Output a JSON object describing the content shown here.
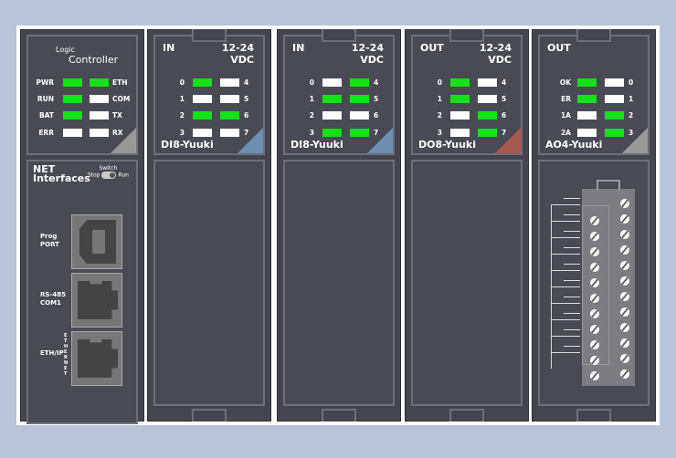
{
  "controller": {
    "title_small": "Logic",
    "title_big": "Controller",
    "leds": [
      {
        "label": "PWR",
        "on": true
      },
      {
        "label": "RUN",
        "on": true
      },
      {
        "label": "BAT",
        "on": true
      },
      {
        "label": "ERR",
        "on": false
      },
      {
        "label": "ETH",
        "on": true
      },
      {
        "label": "COM",
        "on": false
      },
      {
        "label": "TX",
        "on": false
      },
      {
        "label": "RX",
        "on": false
      }
    ],
    "net_title": [
      "NET",
      "Interfaces"
    ],
    "switch_label": "Switch",
    "switch_stop": "Stop",
    "switch_run": "Run",
    "switch_state": "Run",
    "ports": [
      {
        "label": [
          "Prog",
          "PORT"
        ],
        "type": "usb-b"
      },
      {
        "label": [
          "RS-485",
          "COM1"
        ],
        "type": "rj45"
      },
      {
        "label": [
          "ETH/IP"
        ],
        "type": "rj45",
        "side_label": "ETHERNET"
      }
    ]
  },
  "modules": [
    {
      "dir": "IN",
      "volt": [
        "12-24",
        "VDC"
      ],
      "name": "DI8-Yuuki",
      "corner": "#6a8fb0",
      "labels_left": [
        "0",
        "1",
        "2",
        "3"
      ],
      "labels_right": [
        "4",
        "5",
        "6",
        "7"
      ],
      "left_on": [
        true,
        false,
        true,
        false
      ],
      "right_on": [
        false,
        false,
        true,
        false
      ]
    },
    {
      "dir": "IN",
      "volt": [
        "12-24",
        "VDC"
      ],
      "name": "DI8-Yuuki",
      "corner": "#6a8fb0",
      "labels_left": [
        "0",
        "1",
        "2",
        "3"
      ],
      "labels_right": [
        "4",
        "5",
        "6",
        "7"
      ],
      "left_on": [
        false,
        true,
        false,
        true
      ],
      "right_on": [
        true,
        true,
        false,
        true
      ]
    },
    {
      "dir": "OUT",
      "volt": [
        "12-24",
        "VDC"
      ],
      "name": "DO8-Yuuki",
      "corner": "#a85a4e",
      "labels_left": [
        "0",
        "1",
        "2",
        "3"
      ],
      "labels_right": [
        "4",
        "5",
        "6",
        "7"
      ],
      "left_on": [
        true,
        true,
        false,
        false
      ],
      "right_on": [
        false,
        false,
        true,
        true
      ]
    },
    {
      "dir": "OUT",
      "volt": [
        "",
        ""
      ],
      "name": "AO4-Yuuki",
      "corner": "#999999",
      "labels_left": [
        "OK",
        "ER",
        "1A",
        "2A"
      ],
      "labels_right": [
        "0",
        "1",
        "2",
        "3"
      ],
      "left_on": [
        true,
        true,
        false,
        false
      ],
      "right_on": [
        false,
        false,
        true,
        true
      ],
      "terminal_block": true
    }
  ],
  "colors": {
    "led_on": "#16e016",
    "led_off": "#ffffff",
    "module": "#45454f",
    "background": "#b9c4d9"
  }
}
